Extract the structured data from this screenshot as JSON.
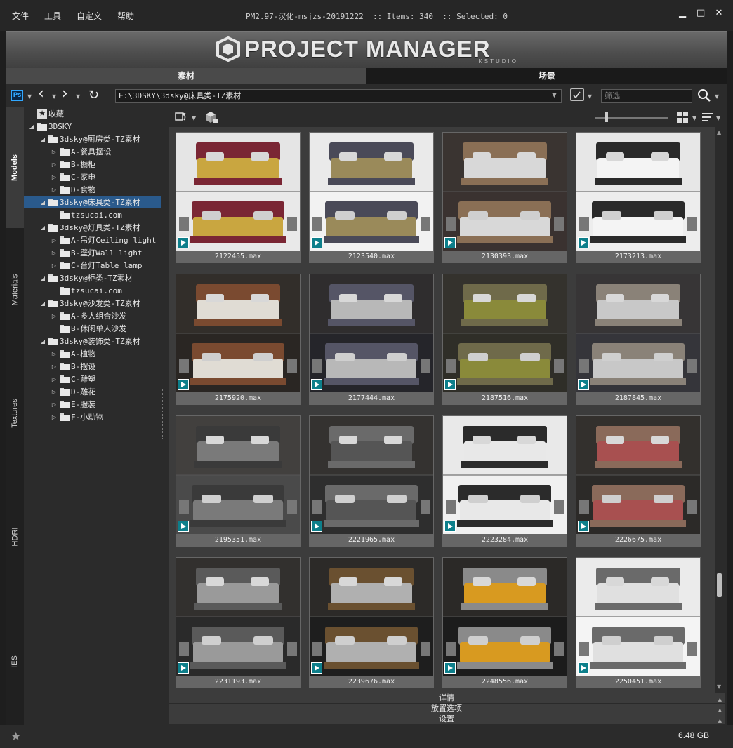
{
  "menu": [
    "文件",
    "工具",
    "自定义",
    "帮助"
  ],
  "title_info": "PM2.97-汉化-msjzs-20191222  :: Items: 340  :: Selected: 0",
  "logo": {
    "main": "PROJECT MANAGER",
    "sub": "KSTUDIO"
  },
  "tabs": {
    "assets": "素材",
    "scenes": "场景"
  },
  "toolbar": {
    "path": "E:\\3DSKY\\3dsky@床具类-TZ素材",
    "filter_placeholder": "筛选",
    "ps_label": "Ps"
  },
  "side_tabs": [
    "Models",
    "Materials",
    "Textures",
    "HDRI",
    "IES"
  ],
  "tree": [
    {
      "label": "收藏",
      "twisty": "",
      "type": "star",
      "selected": false
    },
    {
      "label": "3DSKY",
      "twisty": "◢",
      "type": "folder",
      "selected": false
    },
    {
      "label": "3dsky@厨房类-TZ素材",
      "twisty": "◢",
      "type": "folder",
      "selected": false
    },
    {
      "label": "A-餐具摆设",
      "twisty": "▷",
      "type": "folder",
      "selected": false
    },
    {
      "label": "B-橱柜",
      "twisty": "▷",
      "type": "folder",
      "selected": false
    },
    {
      "label": "C-家电",
      "twisty": "▷",
      "type": "folder",
      "selected": false
    },
    {
      "label": "D-食物",
      "twisty": "▷",
      "type": "folder",
      "selected": false
    },
    {
      "label": "3dsky@床具类-TZ素材",
      "twisty": "◢",
      "type": "folder",
      "selected": true
    },
    {
      "label": "tzsucai.com",
      "twisty": "",
      "type": "folder",
      "selected": false
    },
    {
      "label": "3dsky@灯具类-TZ素材",
      "twisty": "◢",
      "type": "folder",
      "selected": false
    },
    {
      "label": "A-吊灯Ceiling light",
      "twisty": "▷",
      "type": "folder",
      "selected": false
    },
    {
      "label": "B-壁灯Wall light",
      "twisty": "▷",
      "type": "folder",
      "selected": false
    },
    {
      "label": "C-台灯Table lamp",
      "twisty": "▷",
      "type": "folder",
      "selected": false
    },
    {
      "label": "3dsky@柜类-TZ素材",
      "twisty": "◢",
      "type": "folder",
      "selected": false
    },
    {
      "label": "tzsucai.com",
      "twisty": "",
      "type": "folder",
      "selected": false
    },
    {
      "label": "3dsky@沙发类-TZ素材",
      "twisty": "◢",
      "type": "folder",
      "selected": false
    },
    {
      "label": "A-多人组合沙发",
      "twisty": "▷",
      "type": "folder",
      "selected": false
    },
    {
      "label": "B-休闲单人沙发",
      "twisty": "",
      "type": "folder",
      "selected": false
    },
    {
      "label": "3dsky@装饰类-TZ素材",
      "twisty": "◢",
      "type": "folder",
      "selected": false
    },
    {
      "label": "A-植物",
      "twisty": "▷",
      "type": "folder",
      "selected": false
    },
    {
      "label": "B-摆设",
      "twisty": "▷",
      "type": "folder",
      "selected": false
    },
    {
      "label": "C-雕塑",
      "twisty": "▷",
      "type": "folder",
      "selected": false
    },
    {
      "label": "D-雕花",
      "twisty": "▷",
      "type": "folder",
      "selected": false
    },
    {
      "label": "E-服装",
      "twisty": "▷",
      "type": "folder",
      "selected": false
    },
    {
      "label": "F-小动物",
      "twisty": "▷",
      "type": "folder",
      "selected": false
    }
  ],
  "items": [
    {
      "name": "2122455.max",
      "bg": "#e9e9e9",
      "bed": "#7a2634",
      "sheet": "#c9a640",
      "light": true
    },
    {
      "name": "2123540.max",
      "bg": "#f2f2f2",
      "bed": "#4a4a58",
      "sheet": "#9a8a5a",
      "light": true
    },
    {
      "name": "2130393.max",
      "bg": "#3a3230",
      "bed": "#8a6f55",
      "sheet": "#d8d8d8",
      "light": false
    },
    {
      "name": "2173213.max",
      "bg": "#ededed",
      "bed": "#2a2a2a",
      "sheet": "#f4f4f4",
      "light": true
    },
    {
      "name": "2175920.max",
      "bg": "#2a2623",
      "bed": "#7a4a30",
      "sheet": "#e0dcd4",
      "light": false
    },
    {
      "name": "2177444.max",
      "bg": "#25252a",
      "bed": "#555566",
      "sheet": "#b8b8b8",
      "light": false
    },
    {
      "name": "2187516.max",
      "bg": "#2f2e28",
      "bed": "#6f6a4a",
      "sheet": "#8a8a3a",
      "light": false
    },
    {
      "name": "2187845.max",
      "bg": "#35353a",
      "bed": "#8a8278",
      "sheet": "#c8c8c8",
      "light": false
    },
    {
      "name": "2195351.max",
      "bg": "#4a4a4a",
      "bed": "#3a3a3a",
      "sheet": "#7a7a7a",
      "light": false
    },
    {
      "name": "2221965.max",
      "bg": "#2e2e2e",
      "bed": "#6a6a6a",
      "sheet": "#555555",
      "light": false
    },
    {
      "name": "2223284.max",
      "bg": "#f0f0f0",
      "bed": "#2b2b2b",
      "sheet": "#e8e8e8",
      "light": true
    },
    {
      "name": "2226675.max",
      "bg": "#2c2a28",
      "bed": "#8a6a5a",
      "sheet": "#a85050",
      "light": false
    },
    {
      "name": "2231193.max",
      "bg": "#2a2a2a",
      "bed": "#5a5a5a",
      "sheet": "#9a9a9a",
      "light": false
    },
    {
      "name": "2239676.max",
      "bg": "#1e1e1e",
      "bed": "#6a5030",
      "sheet": "#b0b0b0",
      "light": false
    },
    {
      "name": "2248556.max",
      "bg": "#1c1c1c",
      "bed": "#8a8a8a",
      "sheet": "#d89a20",
      "light": false
    },
    {
      "name": "2250451.max",
      "bg": "#f4f4f4",
      "bed": "#6a6a6a",
      "sheet": "#e0e0e0",
      "light": true
    }
  ],
  "rollouts": [
    "详情",
    "放置选项",
    "设置"
  ],
  "status": {
    "disk": "6.48 GB"
  }
}
